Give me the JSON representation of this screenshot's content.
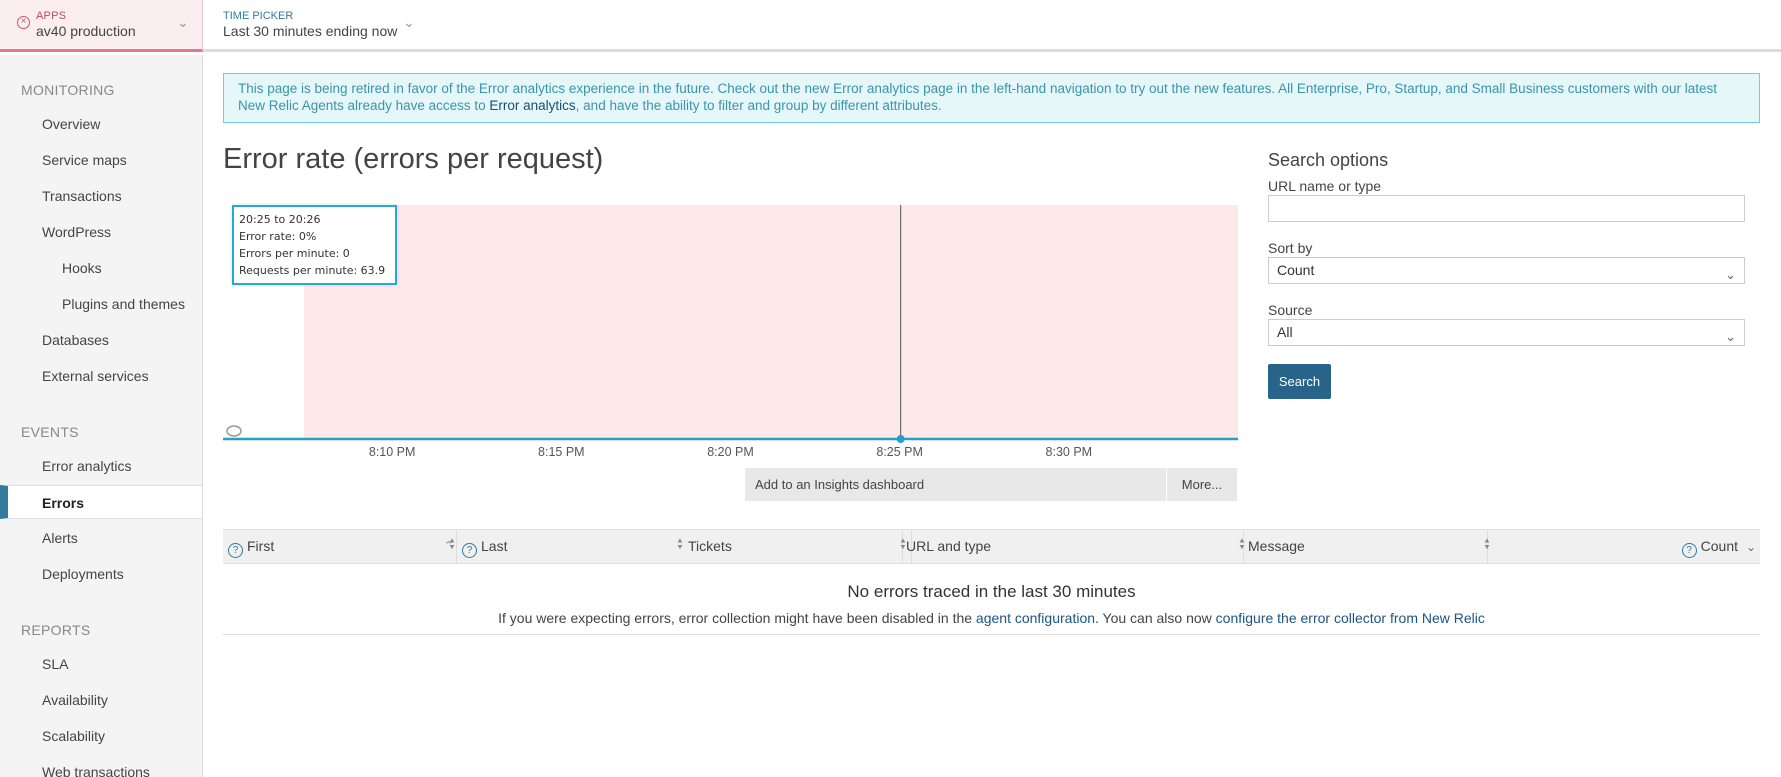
{
  "topbar": {
    "apps_label": "APPS",
    "app_name": "av40 production",
    "time_label": "TIME PICKER",
    "time_value": "Last 30 minutes ending now"
  },
  "sidebar": {
    "sections": [
      {
        "label": "MONITORING"
      },
      {
        "label": "EVENTS"
      },
      {
        "label": "REPORTS"
      }
    ],
    "items": [
      {
        "label": "Overview"
      },
      {
        "label": "Service maps"
      },
      {
        "label": "Transactions"
      },
      {
        "label": "WordPress"
      },
      {
        "label": "Hooks"
      },
      {
        "label": "Plugins and themes"
      },
      {
        "label": "Databases"
      },
      {
        "label": "External services"
      },
      {
        "label": "Error analytics"
      },
      {
        "label": "Errors"
      },
      {
        "label": "Alerts"
      },
      {
        "label": "Deployments"
      },
      {
        "label": "SLA"
      },
      {
        "label": "Availability"
      },
      {
        "label": "Scalability"
      },
      {
        "label": "Web transactions"
      }
    ]
  },
  "banner": {
    "text_1": "This page is being retired in favor of the Error analytics experience in the future. Check out the new Error analytics page in the left-hand navigation to try out the new features. All Enterprise, Pro, Startup, and Small Business customers with our latest New Relic Agents already have access to ",
    "link": "Error analytics",
    "text_2": ", and have the ability to filter and group by different attributes."
  },
  "chart": {
    "title": "Error rate (errors per request)",
    "tooltip": {
      "range": "20:25 to 20:26",
      "error_rate": "Error rate: 0%",
      "errors_per_minute": "Errors per minute: 0",
      "requests_per_minute": "Requests per minute: 63.9"
    },
    "add_insights": "Add to an Insights dashboard",
    "more": "More...",
    "colors": {
      "band": "#fde8ea",
      "line": "#27a0c9",
      "marker": "#555555"
    }
  },
  "chart_data": {
    "type": "area",
    "title": "Error rate (errors per request)",
    "x_ticks": [
      "8:10 PM",
      "8:15 PM",
      "8:20 PM",
      "8:25 PM",
      "8:30 PM"
    ],
    "x_start": "8:05 PM",
    "x_end": "8:35 PM",
    "series": [
      {
        "values": [
          0,
          0,
          0,
          0,
          0,
          0,
          0,
          0,
          0,
          0,
          0,
          0,
          0,
          0,
          0,
          0,
          0,
          0,
          0,
          0,
          0,
          0,
          0,
          0,
          0,
          0,
          0,
          0,
          0,
          0
        ]
      }
    ],
    "highlight_time": "8:25 PM",
    "ylim": [
      0,
      1
    ],
    "grid": false
  },
  "search_options": {
    "title": "Search options",
    "url_label": "URL name or type",
    "url_value": "",
    "sort_label": "Sort by",
    "sort_value": "Count",
    "source_label": "Source",
    "source_value": "All",
    "search_button": "Search"
  },
  "table": {
    "columns": [
      {
        "label": "First"
      },
      {
        "label": "Last"
      },
      {
        "label": "Tickets"
      },
      {
        "label": "URL and type"
      },
      {
        "label": "Message"
      },
      {
        "label": "Count"
      }
    ],
    "empty_title": "No errors traced in the last 30 minutes",
    "empty_text_1": "If you were expecting errors, error collection might have been disabled in the ",
    "empty_link_1": "agent configuration",
    "empty_text_2": ". You can also now ",
    "empty_link_2": "configure the error collector from New Relic"
  }
}
